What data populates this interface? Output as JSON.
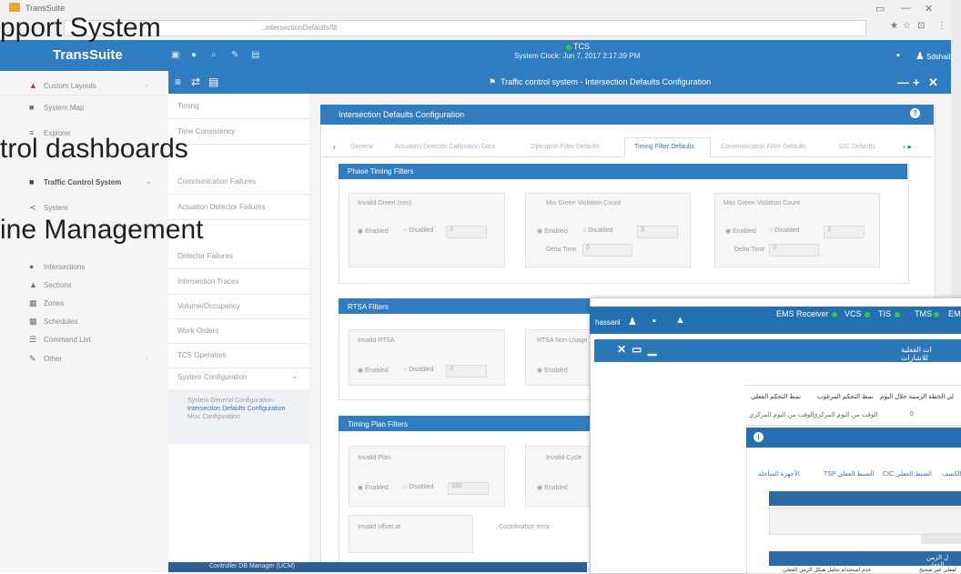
{
  "browser": {
    "tab_title": "TransSuite",
    "url_fragment": "...intersectionDefaults/fit",
    "window_controls": [
      "▭",
      "—",
      "✕"
    ],
    "icons": [
      "★",
      "☆",
      "⊡",
      "⋮"
    ]
  },
  "header": {
    "brand": "TransSuite",
    "clock": "System Clock: Jun 7, 2017 2:17:39 PM",
    "vcs_label": "TCS",
    "user": "Sdshaiba",
    "toolbar_icons": [
      "▣",
      "●",
      "⌕",
      "✎",
      "▤"
    ]
  },
  "overlay_text": [
    "pport System",
    "trol dashboards",
    "ine Management"
  ],
  "sidebar": {
    "items": [
      {
        "icon": "▲",
        "label": "Custom Layouts"
      },
      {
        "icon": "■",
        "label": "System Map"
      },
      {
        "icon": "≡",
        "label": "Explorer"
      },
      {
        "icon": "■",
        "label": "Traffic Control System"
      },
      {
        "icon": "≺",
        "label": "System"
      },
      {
        "icon": "●",
        "label": "Intersections"
      },
      {
        "icon": "▲",
        "label": "Sections"
      },
      {
        "icon": "▦",
        "label": "Zones"
      },
      {
        "icon": "▦",
        "label": "Schedules"
      },
      {
        "icon": "☰",
        "label": "Command List"
      },
      {
        "icon": "✎",
        "label": "Other"
      }
    ]
  },
  "module_bar": {
    "title": "Traffic control system - Intersection Defaults Configuration",
    "icons": [
      "≡",
      "⇄",
      "▤"
    ],
    "controls": [
      "—",
      "+",
      "✕"
    ]
  },
  "menu": {
    "items": [
      "Timing",
      "Time Consistency",
      "Communication Failures",
      "Actuation Detector Failures",
      "Detector Failures",
      "Intersection Traces",
      "Volume/Occupancy",
      "Work Orders",
      "TCS Operators",
      "System Configuration"
    ],
    "submenu": [
      "System General Configuration",
      "Intersection Defaults Configuration",
      "Misc Configuration"
    ]
  },
  "panel": {
    "title": "Intersection Defaults Configuration",
    "tabs": [
      "General",
      "Actuation Detector Calibration Data",
      "Operation Filter Defaults",
      "Timing Filter Defaults",
      "Communication Filter Defaults",
      "CIC Defaults"
    ],
    "sections": [
      {
        "title": "Phase Timing Filters",
        "boxes": [
          {
            "title": "Invalid Green (sec)",
            "enabled": "Enabled",
            "disabled": "Disabled",
            "value": "3"
          },
          {
            "title": "Min Green Violation Count",
            "enabled": "Enabled",
            "disabled": "Disabled",
            "value": "3",
            "delta_label": "Delta Time",
            "delta_value": "0"
          },
          {
            "title": "Max Green Violation Count",
            "enabled": "Enabled",
            "disabled": "Disabled",
            "value": "3",
            "delta_label": "Delta Time",
            "delta_value": "0"
          }
        ]
      },
      {
        "title": "RTSA Filters",
        "boxes": [
          {
            "title": "Invalid RTSA",
            "enabled": "Enabled",
            "disabled": "Disabled",
            "value": "3"
          },
          {
            "title": "RTSA Non-Usage",
            "enabled": "Enabled"
          }
        ]
      },
      {
        "title": "Timing Plan Filters",
        "boxes": [
          {
            "title": "Invalid Plan",
            "enabled": "Enabled",
            "disabled": "Disabled",
            "value": "180"
          },
          {
            "title": "Invalid Cycle",
            "enabled": "Enabled"
          },
          {
            "title": "Invalid offset at"
          },
          {
            "title": "Coordination error"
          }
        ]
      }
    ],
    "bottom_bar": "Controller DB Manager (UCM)"
  },
  "arabic_window": {
    "user": "hassanl",
    "status": [
      "EMS Receiver",
      "VCS",
      "TIS",
      "TMS",
      "EM"
    ],
    "header": "ات الفعلية للاشارات",
    "table_headers": [
      "نمط التحكم الفعلي",
      "نمط التحكم المرغوب",
      "الخطة الزمنية خلال اليوم",
      "لي"
    ],
    "table_row": [
      "الوقت من اليوم المركزي",
      "الوقت من اليوم المركزي",
      "0"
    ],
    "tabs": [
      "الأجهزة الساحلة",
      "TSP الضبط الفعلي",
      "CIC الضبط الفعلي",
      "الكشف"
    ],
    "inner_head_label": "ل الزمن الفعلي",
    "inner_row": [
      "عدم استخدام تحليل هيكل الزمن الفعلي",
      "لفعلي غير صحيح"
    ]
  },
  "colors": {
    "header_blue": "#2f7cc0",
    "status_green": "#2ecc40"
  }
}
